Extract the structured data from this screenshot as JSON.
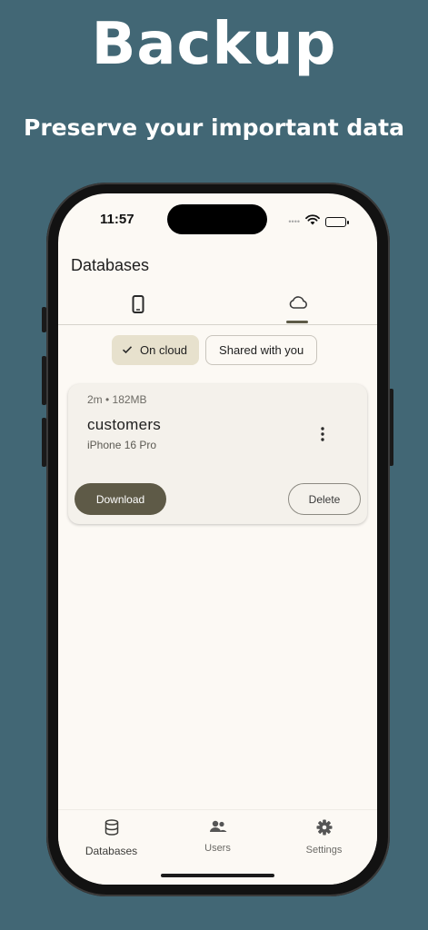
{
  "promo": {
    "headline": "Backup",
    "subline": "Preserve your important data"
  },
  "status_bar": {
    "time": "11:57",
    "signal_dots": "••••"
  },
  "app": {
    "title": "Databases",
    "tabs": [
      {
        "icon": "phone-icon",
        "active": false
      },
      {
        "icon": "cloud-icon",
        "active": true
      }
    ],
    "filters": [
      {
        "label": "On cloud",
        "selected": true
      },
      {
        "label": "Shared with you",
        "selected": false
      }
    ],
    "database_card": {
      "meta": "2m • 182MB",
      "name": "customers",
      "device": "iPhone 16 Pro",
      "download_label": "Download",
      "delete_label": "Delete"
    },
    "bottom_nav": [
      {
        "label": "Databases",
        "icon": "database-icon",
        "active": true
      },
      {
        "label": "Users",
        "icon": "users-icon",
        "active": false
      },
      {
        "label": "Settings",
        "icon": "gear-icon",
        "active": false
      }
    ]
  },
  "colors": {
    "background": "#426775",
    "accent": "#5e5a47",
    "chip_selected": "#e7e1cd",
    "surface": "#fcf9f4"
  }
}
